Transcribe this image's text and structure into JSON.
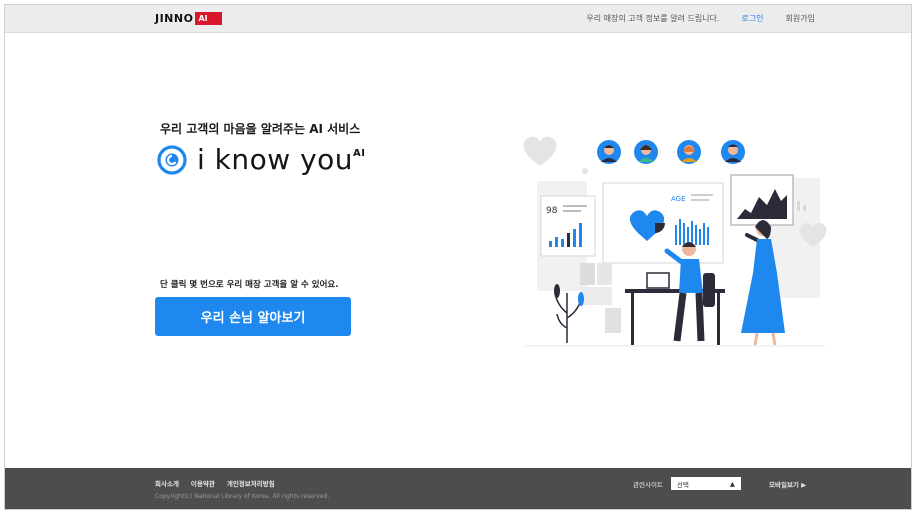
{
  "header": {
    "logo_text": "JINNO",
    "logo_badge": "AI",
    "nav": [
      {
        "label": "우리 매장의 고객 정보를 알려 드립니다.",
        "active": false
      },
      {
        "label": "로그인",
        "active": true
      },
      {
        "label": "회원가입",
        "active": false
      }
    ]
  },
  "hero": {
    "headline": "우리 고객의 마음을 알려주는 AI 서비스",
    "brand_name": "i know you",
    "brand_sup": "AI",
    "subcopy": "단 클릭 몇 번으로 우리 매장 고객을 알 수 있어요.",
    "cta_label": "우리 손님 알아보기"
  },
  "illustration": {
    "age_label": "AGE",
    "colors": {
      "blue": "#1e88ef",
      "dark": "#2b2b3a",
      "grey": "#e9e9e9",
      "skin": "#f0b89a"
    }
  },
  "footer": {
    "links": [
      "회사소개",
      "이용약관",
      "개인정보처리방침"
    ],
    "copyright": "Copyright(c) National Library of Korea. All rights reserved.",
    "related_label": "관련사이트",
    "related_value": "선택",
    "mobile_label": "모바일보기 ▶"
  },
  "colors": {
    "accent": "#1e88ef",
    "brand_red": "#d7182a",
    "footer_bg": "#4d4d4d"
  }
}
